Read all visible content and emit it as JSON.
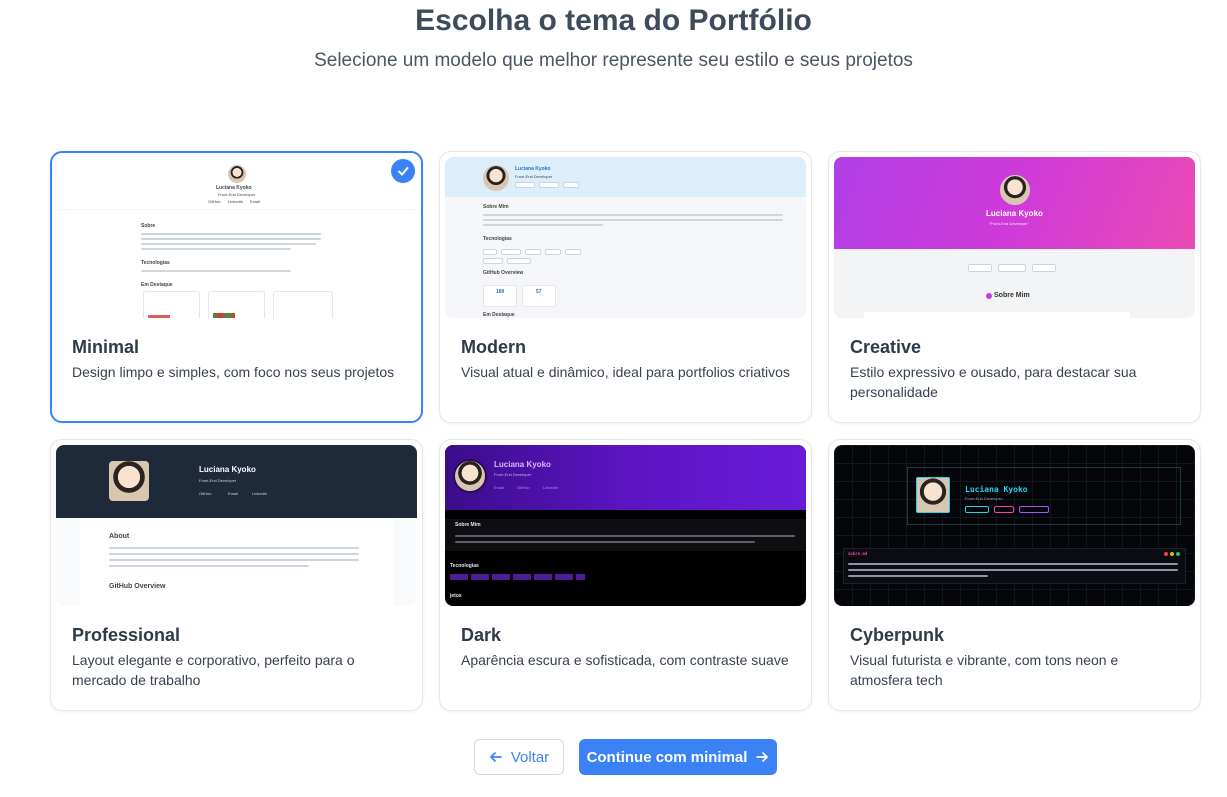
{
  "header": {
    "title": "Escolha o tema do Portfólio",
    "subtitle": "Selecione um modelo que melhor represente seu estilo e seus projetos"
  },
  "preview_profile": {
    "name": "Luciana Kyoko",
    "role": "Front-End Developer",
    "creative_role": "\"Front-End Developer\"",
    "github": "GitHub",
    "linkedin": "LinkedIn",
    "email": "Email",
    "about": "Sobre",
    "about_me": "Sobre Mim",
    "about_en": "About",
    "technologies": "Tecnologias",
    "highlights": "Em Destaque",
    "github_overview": "GitHub Overview",
    "stat_1": "189",
    "stat_2": "57",
    "projects_fragment": "jetos",
    "code_tag": "sobre.md"
  },
  "themes": [
    {
      "id": "minimal",
      "title": "Minimal",
      "description": "Design limpo e simples, com foco nos seus projetos",
      "selected": true
    },
    {
      "id": "modern",
      "title": "Modern",
      "description": "Visual atual e dinâmico, ideal para portfolios criativos",
      "selected": false
    },
    {
      "id": "creative",
      "title": "Creative",
      "description": "Estilo expressivo e ousado, para destacar sua personalidade",
      "selected": false
    },
    {
      "id": "professional",
      "title": "Professional",
      "description": "Layout elegante e corporativo, perfeito para o mercado de trabalho",
      "selected": false
    },
    {
      "id": "dark",
      "title": "Dark",
      "description": "Aparência escura e sofisticada, com contraste suave",
      "selected": false
    },
    {
      "id": "cyberpunk",
      "title": "Cyberpunk",
      "description": "Visual futurista e vibrante, com tons neon e atmosfera tech",
      "selected": false
    }
  ],
  "footer": {
    "back_label": "Voltar",
    "continue_label": "Continue com minimal"
  },
  "colors": {
    "accent": "#3b82f6",
    "creative_gradient": "#c13de8",
    "dark_purple": "#5b14c2",
    "cyber_pink": "#ff3fa4",
    "cyber_cyan": "#22d3ee"
  }
}
